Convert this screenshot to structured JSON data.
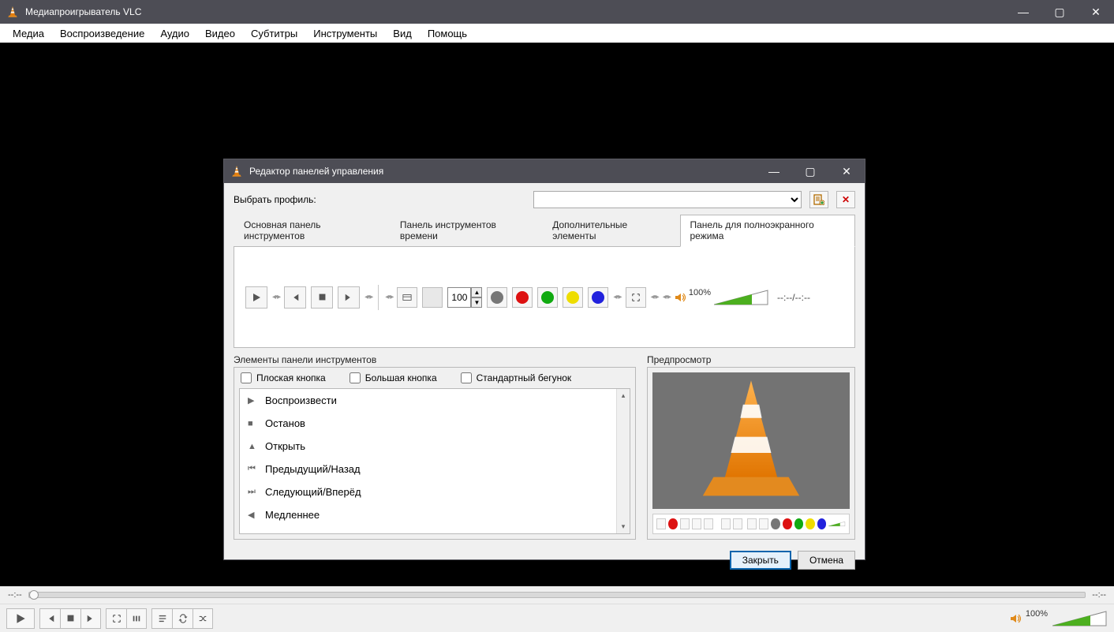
{
  "window": {
    "title": "Медиапроигрыватель VLC",
    "minimize": "—",
    "maximize": "▢",
    "close": "✕"
  },
  "menubar": [
    "Медиа",
    "Воспроизведение",
    "Аудио",
    "Видео",
    "Субтитры",
    "Инструменты",
    "Вид",
    "Помощь"
  ],
  "seek": {
    "time_left": "--:--",
    "time_right": "--:--"
  },
  "volume": {
    "percent": "100%"
  },
  "dialog": {
    "title": "Редактор панелей управления",
    "profile_label": "Выбрать профиль:",
    "tabs": {
      "t1": "Основная панель инструментов",
      "t2": "Панель инструментов времени",
      "t3": "Дополнительные элементы",
      "t4": "Панель для полноэкранного режима"
    },
    "spin_value": "100",
    "toolbar_volume_percent": "100%",
    "toolbar_time": "--:--/--:--",
    "elements_label": "Элементы панели инструментов",
    "preview_label": "Предпросмотр",
    "checkbox_flat": "Плоская кнопка",
    "checkbox_big": "Большая кнопка",
    "checkbox_slider": "Стандартный бегунок",
    "items": {
      "i0": "Воспроизвести",
      "i1": "Останов",
      "i2": "Открыть",
      "i3": "Предыдущий/Назад",
      "i4": "Следующий/Вперёд",
      "i5": "Медленнее"
    },
    "close_btn": "Закрыть",
    "cancel_btn": "Отмена"
  }
}
